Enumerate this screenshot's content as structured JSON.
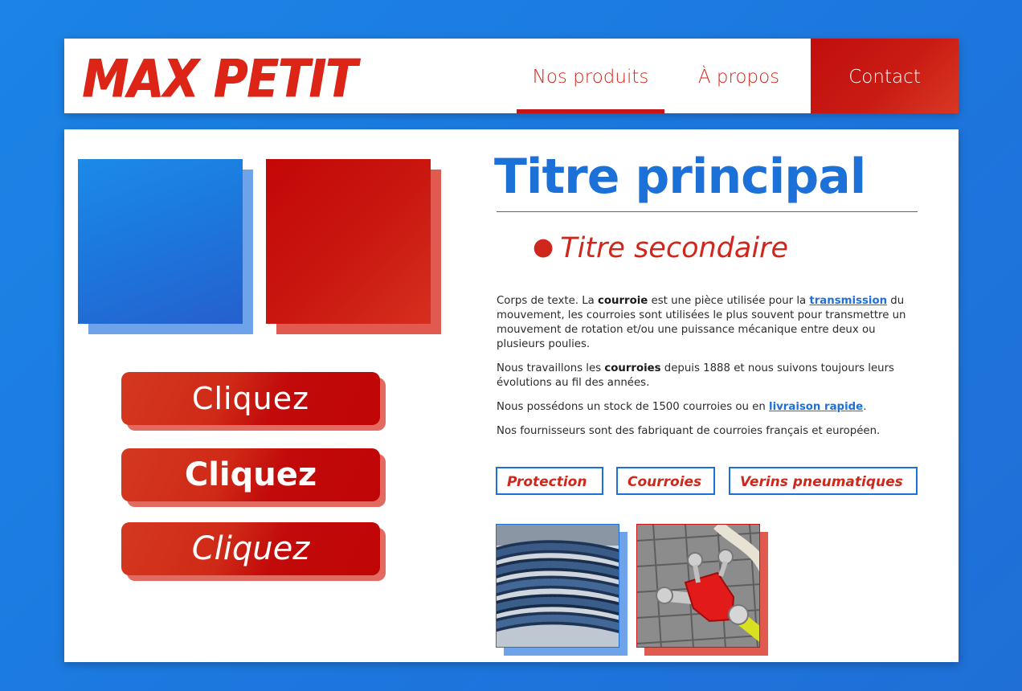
{
  "header": {
    "logo": "MAX PETIT",
    "nav": {
      "products": "Nos produits",
      "about": "À propos",
      "contact": "Contact"
    }
  },
  "buttons": [
    "Cliquez",
    "Cliquez",
    "Cliquez"
  ],
  "main": {
    "title": "Titre principal",
    "subtitle_bullet": "●",
    "subtitle": "Titre secondaire",
    "p1": {
      "a": "Corps de texte. La ",
      "b": "courroie",
      "c": " est une pièce utilisée pour la ",
      "link": "transmission",
      "d": " du mouvement, les courroies sont utilisées le plus souvent pour transmettre un mouvement de rotation et/ou une puissance mécanique entre deux ou plusieurs poulies."
    },
    "p2": {
      "a": "Nous travaillons les ",
      "b": "courroies",
      "c": " depuis 1888 et nous suivons toujours leurs évolutions au fil des années."
    },
    "p3": {
      "a": "Nous possédons un stock de 1500 courroies ou en ",
      "link": "livraison rapide",
      "b": "."
    },
    "p4": "Nos fournisseurs sont des fabriquant de courroies français et européen."
  },
  "tags": [
    "Protection",
    "Courroies",
    "Verins pneumatiques"
  ],
  "colors": {
    "background": "#1d7ae0",
    "brand_red": "#d0271c",
    "brand_blue": "#1c71d8"
  }
}
